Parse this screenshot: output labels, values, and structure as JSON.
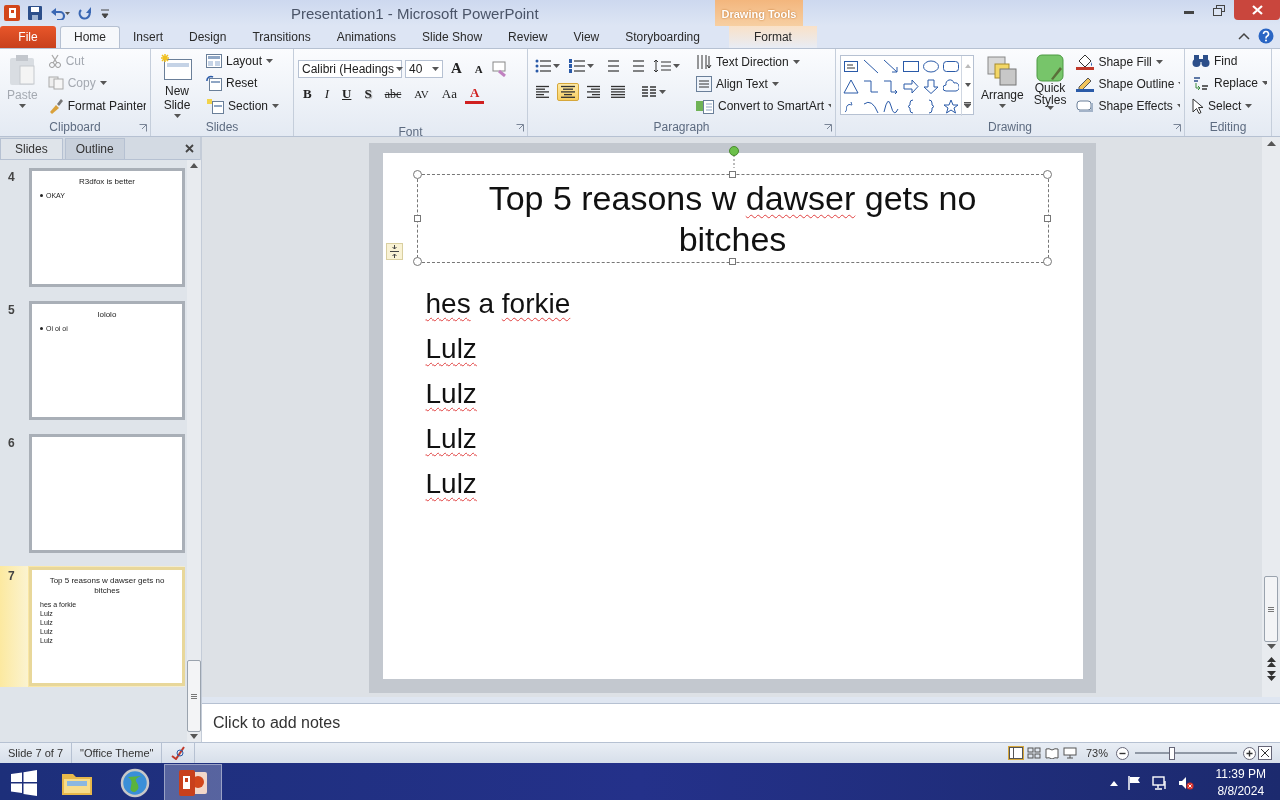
{
  "window": {
    "title": "Presentation1 - Microsoft PowerPoint",
    "contextual_group": "Drawing Tools"
  },
  "tabs": [
    {
      "label": "File",
      "kind": "file",
      "selected": false
    },
    {
      "label": "Home",
      "kind": "tab",
      "selected": true
    },
    {
      "label": "Insert",
      "kind": "tab",
      "selected": false
    },
    {
      "label": "Design",
      "kind": "tab",
      "selected": false
    },
    {
      "label": "Transitions",
      "kind": "tab",
      "selected": false
    },
    {
      "label": "Animations",
      "kind": "tab",
      "selected": false
    },
    {
      "label": "Slide Show",
      "kind": "tab",
      "selected": false
    },
    {
      "label": "Review",
      "kind": "tab",
      "selected": false
    },
    {
      "label": "View",
      "kind": "tab",
      "selected": false
    },
    {
      "label": "Storyboarding",
      "kind": "tab",
      "selected": false
    },
    {
      "label": "Format",
      "kind": "contextual",
      "selected": false
    }
  ],
  "ribbon": {
    "clipboard": {
      "label": "Clipboard",
      "paste": {
        "label": "Paste",
        "disabled": true
      },
      "items": [
        {
          "label": "Cut",
          "kind": "cut",
          "disabled": true,
          "dropdown": false
        },
        {
          "label": "Copy",
          "kind": "copy",
          "disabled": true,
          "dropdown": true
        },
        {
          "label": "Format Painter",
          "kind": "painter",
          "disabled": false,
          "dropdown": false
        }
      ]
    },
    "slides": {
      "label": "Slides",
      "new_slide": "New Slide",
      "items": [
        {
          "label": "Layout",
          "kind": "layout",
          "dropdown": true
        },
        {
          "label": "Reset",
          "kind": "reset",
          "dropdown": false
        },
        {
          "label": "Section",
          "kind": "section",
          "dropdown": true
        }
      ]
    },
    "font": {
      "label": "Font",
      "font_name": "Calibri (Headings",
      "font_size": "40",
      "grow": "A",
      "shrink": "A",
      "format_buttons": [
        {
          "label": "B",
          "kind": "bold"
        },
        {
          "label": "I",
          "kind": "italic"
        },
        {
          "label": "U",
          "kind": "underline"
        },
        {
          "label": "S",
          "kind": "shadow"
        },
        {
          "label": "abc",
          "kind": "strike"
        },
        {
          "label": "AV",
          "kind": "spacing"
        },
        {
          "label": "Aa",
          "kind": "case"
        },
        {
          "label": "A",
          "kind": "color"
        }
      ]
    },
    "paragraph": {
      "label": "Paragraph",
      "alignments": [
        {
          "kind": "left",
          "selected": false
        },
        {
          "kind": "center",
          "selected": true
        },
        {
          "kind": "right",
          "selected": false
        },
        {
          "kind": "justify",
          "selected": false
        }
      ],
      "items": [
        {
          "label": "Text Direction",
          "kind": "direction"
        },
        {
          "label": "Align Text",
          "kind": "align"
        },
        {
          "label": "Convert to SmartArt",
          "kind": "smartart"
        }
      ]
    },
    "drawing": {
      "label": "Drawing",
      "arrange": "Arrange",
      "quick_styles": "Quick Styles",
      "items": [
        {
          "label": "Shape Fill",
          "kind": "fill"
        },
        {
          "label": "Shape Outline",
          "kind": "outline"
        },
        {
          "label": "Shape Effects",
          "kind": "effects"
        }
      ]
    },
    "editing": {
      "label": "Editing",
      "items": [
        {
          "label": "Find",
          "kind": "find",
          "dropdown": false
        },
        {
          "label": "Replace",
          "kind": "replace",
          "dropdown": true
        },
        {
          "label": "Select",
          "kind": "select",
          "dropdown": true
        }
      ]
    }
  },
  "slide_pane": {
    "tabs": [
      {
        "label": "Slides",
        "selected": true
      },
      {
        "label": "Outline",
        "selected": false
      }
    ],
    "thumbnails": [
      {
        "number": "4",
        "title": "R3dfox is better",
        "body": [
          {
            "text": "OKAY",
            "bulleted": true
          }
        ],
        "selected": false
      },
      {
        "number": "5",
        "title": "lololo",
        "body": [
          {
            "text": "Oi oi oi",
            "bulleted": true
          }
        ],
        "selected": false
      },
      {
        "number": "6",
        "selected": false
      },
      {
        "number": "7",
        "title": "Top 5 reasons w dawser gets no bitches",
        "body": [
          {
            "text": "hes a forkie",
            "bulleted": false
          },
          {
            "text": "Lulz",
            "bulleted": false
          },
          {
            "text": "Lulz",
            "bulleted": false
          },
          {
            "text": "Lulz",
            "bulleted": false
          },
          {
            "text": "Lulz",
            "bulleted": false
          }
        ],
        "selected": true
      }
    ]
  },
  "slide": {
    "title": [
      {
        "text": "Top 5 reasons w",
        "misspelled": false
      },
      {
        "text": "dawser",
        "misspelled": true
      },
      {
        "text": "gets no bitches",
        "misspelled": false
      }
    ],
    "body": [
      {
        "segments": [
          {
            "text": "hes",
            "misspelled": true
          },
          {
            "text": "a",
            "misspelled": false
          },
          {
            "text": "forkie",
            "misspelled": true
          }
        ]
      },
      {
        "segments": [
          {
            "text": "Lulz",
            "misspelled": true
          }
        ]
      },
      {
        "segments": [
          {
            "text": "Lulz",
            "misspelled": true
          }
        ]
      },
      {
        "segments": [
          {
            "text": "Lulz",
            "misspelled": true
          }
        ]
      },
      {
        "segments": [
          {
            "text": "Lulz",
            "misspelled": true
          }
        ]
      }
    ]
  },
  "notes": {
    "placeholder": "Click to add notes"
  },
  "status_bar": {
    "slide_info": "Slide 7 of 7",
    "theme": "\"Office Theme\"",
    "views": [
      {
        "kind": "normal",
        "selected": true
      },
      {
        "kind": "sorter",
        "selected": false
      },
      {
        "kind": "reading",
        "selected": false
      },
      {
        "kind": "show",
        "selected": false
      }
    ],
    "zoom": "73%",
    "zoom_slider": {
      "level": 0.36
    }
  },
  "taskbar": {
    "apps": [
      {
        "kind": "folder",
        "selected": false
      },
      {
        "kind": "browser",
        "selected": false
      },
      {
        "kind": "powerpoint",
        "selected": true
      }
    ],
    "time": "11:39 PM",
    "date": "8/8/2024"
  }
}
